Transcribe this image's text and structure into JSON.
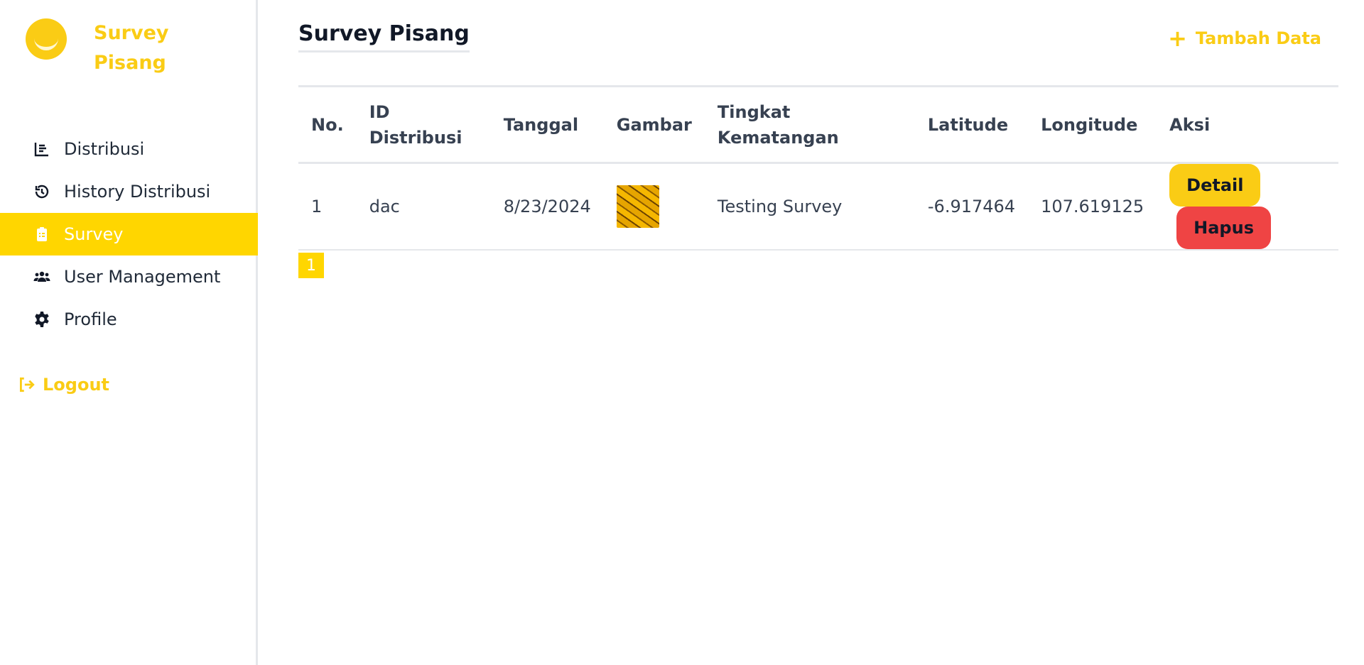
{
  "brand": {
    "title": "Survey Pisang"
  },
  "sidebar": {
    "items": [
      {
        "label": "Distribusi",
        "icon": "chart-bar-icon",
        "active": false
      },
      {
        "label": "History Distribusi",
        "icon": "history-icon",
        "active": false
      },
      {
        "label": "Survey",
        "icon": "clipboard-list-icon",
        "active": true
      },
      {
        "label": "User Management",
        "icon": "users-icon",
        "active": false
      },
      {
        "label": "Profile",
        "icon": "gear-icon",
        "active": false
      }
    ],
    "logout_label": "Logout"
  },
  "main": {
    "title": "Survey Pisang",
    "add_label": "Tambah Data",
    "columns": [
      "No.",
      "ID Distribusi",
      "Tanggal",
      "Gambar",
      "Tingkat Kematangan",
      "Latitude",
      "Longitude",
      "Aksi"
    ],
    "rows": [
      {
        "no": "1",
        "id_distribusi": "dac",
        "tanggal": "8/23/2024",
        "gambar": "banana-thumbnail",
        "tingkat_kematangan": "Testing Survey",
        "latitude": "-6.917464",
        "longitude": "107.619125",
        "detail_label": "Detail",
        "hapus_label": "Hapus"
      }
    ],
    "pagination": {
      "current_page": "1"
    }
  },
  "colors": {
    "accent": "#facc15",
    "danger": "#ef4444",
    "active_bg": "#ffd600"
  }
}
